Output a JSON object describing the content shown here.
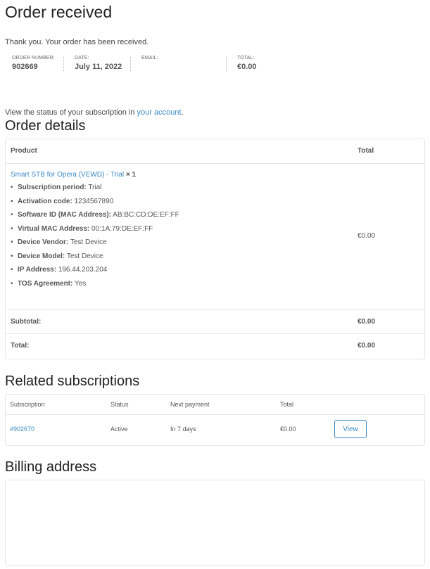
{
  "page": {
    "title": "Order received",
    "thank_you": "Thank you. Your order has been received."
  },
  "overview": [
    {
      "label": "ORDER NUMBER:",
      "value": "902669"
    },
    {
      "label": "DATE:",
      "value": "July 11, 2022"
    },
    {
      "label": "EMAIL:",
      "value": ""
    },
    {
      "label": "TOTAL:",
      "value": "€0.00"
    }
  ],
  "subscription_status": {
    "prefix": "View the status of your subscription in ",
    "link_text": "your account",
    "suffix": "."
  },
  "order_details": {
    "heading": "Order details",
    "col_product": "Product",
    "col_total": "Total",
    "product_name": "Smart STB for Opera (VEWD) - Trial",
    "product_qty": "× 1",
    "meta": [
      {
        "key": "Subscription period:",
        "value": "Trial"
      },
      {
        "key": "Activation code:",
        "value": "1234567890"
      },
      {
        "key": "Software ID (MAC Address):",
        "value": "AB:BC:CD:DE:EF:FF"
      },
      {
        "key": "Virtual MAC Address:",
        "value": "00:1A:79:DE:EF:FF"
      },
      {
        "key": "Device Vendor:",
        "value": "Test Device"
      },
      {
        "key": "Device Model:",
        "value": "Test Device"
      },
      {
        "key": "IP Address:",
        "value": "196.44.203.204"
      },
      {
        "key": "TOS Agreement:",
        "value": "Yes"
      }
    ],
    "line_total": "€0.00",
    "subtotal_label": "Subtotal:",
    "subtotal_value": "€0.00",
    "total_label": "Total:",
    "total_value": "€0.00"
  },
  "related": {
    "heading": "Related subscriptions",
    "columns": [
      "Subscription",
      "Status",
      "Next payment",
      "Total"
    ],
    "row": {
      "id": "#902670",
      "status": "Active",
      "next_payment": "In 7 days",
      "total": "€0.00",
      "action": "View"
    }
  },
  "billing": {
    "heading": "Billing address"
  }
}
